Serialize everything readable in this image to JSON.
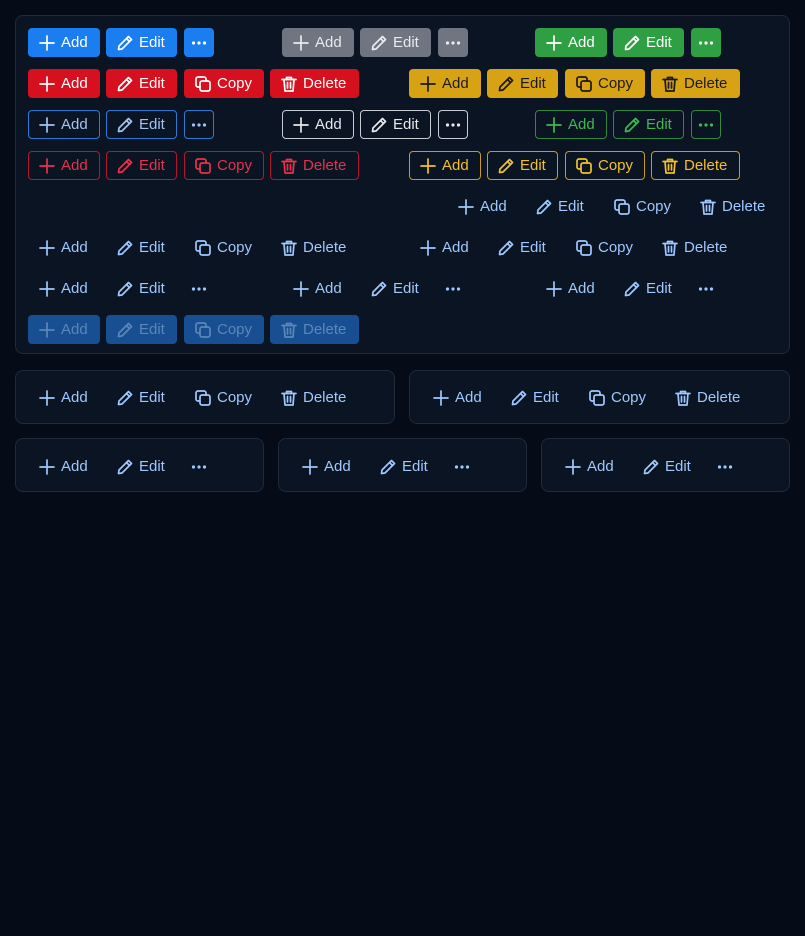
{
  "labels": {
    "add": "Add",
    "edit": "Edit",
    "copy": "Copy",
    "delete": "Delete"
  },
  "colors": {
    "page_bg": "#050b17",
    "panel_bg": "#0b1422",
    "blue": "#1a7df0",
    "gray": "#6f7681",
    "green": "#2ea043",
    "red": "#d6101f",
    "yellow": "#d7a315",
    "ghost_text": "#9ec8ff"
  },
  "icons": {
    "add": "plus-icon",
    "edit": "pencil-icon",
    "copy": "copy-icon",
    "delete": "trash-icon",
    "more": "more-dots-icon"
  },
  "button_groups": [
    {
      "name": "solid-blue-group",
      "buttons": [
        "add",
        "edit",
        "more"
      ]
    },
    {
      "name": "solid-gray-group",
      "buttons": [
        "add",
        "edit",
        "more"
      ]
    },
    {
      "name": "solid-green-group",
      "buttons": [
        "add",
        "edit",
        "more"
      ]
    },
    {
      "name": "solid-red-group",
      "buttons": [
        "add",
        "edit",
        "copy",
        "delete"
      ]
    },
    {
      "name": "solid-yellow-group",
      "buttons": [
        "add",
        "edit",
        "copy",
        "delete"
      ]
    },
    {
      "name": "outline-blue-group",
      "buttons": [
        "add",
        "edit",
        "more"
      ]
    },
    {
      "name": "outline-white-group",
      "buttons": [
        "add",
        "edit",
        "more"
      ]
    },
    {
      "name": "outline-green-group",
      "buttons": [
        "add",
        "edit",
        "more"
      ]
    },
    {
      "name": "outline-red-group",
      "buttons": [
        "add",
        "edit",
        "copy",
        "delete"
      ]
    },
    {
      "name": "outline-yellow-group",
      "buttons": [
        "add",
        "edit",
        "copy",
        "delete"
      ]
    },
    {
      "name": "ghost-group-right",
      "buttons": [
        "add",
        "edit",
        "copy",
        "delete"
      ]
    },
    {
      "name": "ghost-group-left",
      "buttons": [
        "add",
        "edit",
        "copy",
        "delete"
      ]
    },
    {
      "name": "ghost-group-middle",
      "buttons": [
        "add",
        "edit",
        "copy",
        "delete"
      ]
    },
    {
      "name": "ghost-more-group-1",
      "buttons": [
        "add",
        "edit",
        "more"
      ]
    },
    {
      "name": "ghost-more-group-2",
      "buttons": [
        "add",
        "edit",
        "more"
      ]
    },
    {
      "name": "ghost-more-group-3",
      "buttons": [
        "add",
        "edit",
        "more"
      ]
    },
    {
      "name": "disabled-group",
      "buttons": [
        "add",
        "edit",
        "copy",
        "delete"
      ],
      "disabled": true
    },
    {
      "name": "card-1-group",
      "buttons": [
        "add",
        "edit",
        "copy",
        "delete"
      ]
    },
    {
      "name": "card-2-group",
      "buttons": [
        "add",
        "edit",
        "copy",
        "delete"
      ]
    },
    {
      "name": "card-3-group",
      "buttons": [
        "add",
        "edit",
        "more"
      ]
    },
    {
      "name": "card-4-group",
      "buttons": [
        "add",
        "edit",
        "more"
      ]
    },
    {
      "name": "card-5-group",
      "buttons": [
        "add",
        "edit",
        "more"
      ]
    }
  ]
}
